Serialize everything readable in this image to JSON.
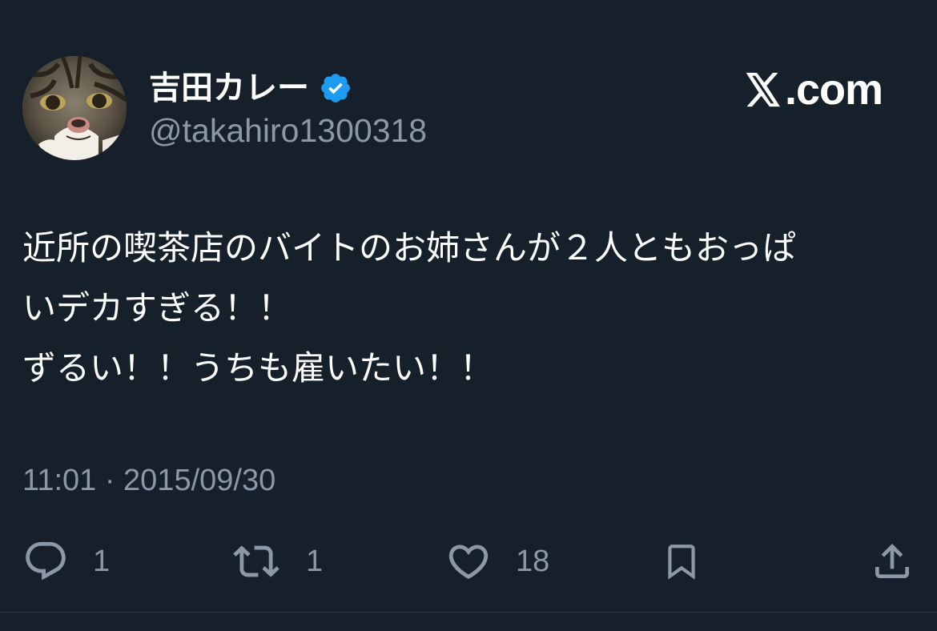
{
  "theme": {
    "background": "#15202b",
    "text_primary": "#ffffff",
    "text_secondary": "#8b98a5",
    "verified_color": "#1d9bf0"
  },
  "user": {
    "display_name": "吉田カレー",
    "handle": "@takahiro1300318",
    "avatar_icon": "cat-avatar",
    "verified_icon": "verified-badge-icon"
  },
  "brand": {
    "logo_icon": "x-logo-icon",
    "domain_suffix": ".com"
  },
  "tweet": {
    "lines": [
      "近所の喫茶店のバイトのお姉さんが２人ともおっぱ",
      "いデカすぎる！！",
      "ずるい！！うちも雇いたい！！"
    ],
    "timestamp": "11:01 · 2015/09/30"
  },
  "actions": {
    "reply_count": "1",
    "retweet_count": "1",
    "like_count": "18",
    "reply_icon": "reply-icon",
    "retweet_icon": "retweet-icon",
    "like_icon": "heart-icon",
    "bookmark_icon": "bookmark-icon",
    "share_icon": "share-icon"
  }
}
